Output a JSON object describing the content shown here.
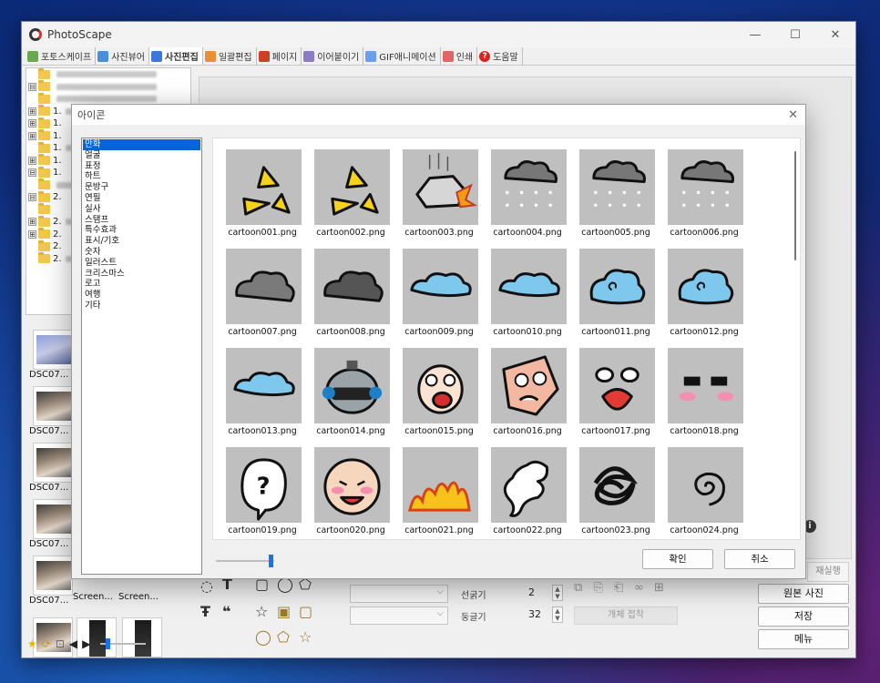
{
  "app": {
    "title": "PhotoScape",
    "window_controls": [
      "—",
      "☐",
      "✕"
    ]
  },
  "tabs": [
    {
      "label": "포토스케이프",
      "icon": "photoscape-icon",
      "color": "#6aa84f"
    },
    {
      "label": "사진뷰어",
      "icon": "viewer-icon",
      "color": "#4a90d9"
    },
    {
      "label": "사진편집",
      "icon": "editor-icon",
      "color": "#3c78d8",
      "active": true
    },
    {
      "label": "일괄편집",
      "icon": "batch-icon",
      "color": "#e69138"
    },
    {
      "label": "페이지",
      "icon": "page-icon",
      "color": "#cc4125"
    },
    {
      "label": "이어붙이기",
      "icon": "combine-icon",
      "color": "#8e7cc3"
    },
    {
      "label": "GIF애니메이션",
      "icon": "gif-icon",
      "color": "#6d9eeb"
    },
    {
      "label": "인쇄",
      "icon": "print-icon",
      "color": "#e06666"
    },
    {
      "label": "도움말",
      "icon": "help-icon",
      "color": "#d8241c"
    }
  ],
  "tree": {
    "rows": [
      {
        "exp": "",
        "label": ""
      },
      {
        "exp": "⊟",
        "label": ""
      },
      {
        "exp": "",
        "label": ""
      },
      {
        "exp": "⊞",
        "label": "1."
      },
      {
        "exp": "⊞",
        "label": "1."
      },
      {
        "exp": "⊞",
        "label": "1."
      },
      {
        "exp": "",
        "label": "1."
      },
      {
        "exp": "⊞",
        "label": "1."
      },
      {
        "exp": "⊟",
        "label": "1."
      },
      {
        "exp": "",
        "label": ""
      },
      {
        "exp": "⊟",
        "label": "2."
      },
      {
        "exp": "",
        "label": ""
      },
      {
        "exp": "⊞",
        "label": "2."
      },
      {
        "exp": "⊞",
        "label": "2."
      },
      {
        "exp": "",
        "label": "2."
      },
      {
        "exp": "",
        "label": "2."
      }
    ]
  },
  "thumbnails": [
    {
      "label": "DSC07...",
      "kind": "blue"
    },
    {
      "label": "DSC07...",
      "kind": "photo"
    },
    {
      "label": "DSC07...",
      "kind": "photo"
    },
    {
      "label": "DSC07...",
      "kind": "photo"
    },
    {
      "label": "DSC07...",
      "kind": "photo"
    },
    {
      "label": "Screen...",
      "kind": "dark"
    },
    {
      "label": "Screen...",
      "kind": "dark"
    },
    {
      "label": "",
      "kind": "photo"
    },
    {
      "label": "",
      "kind": "dark"
    },
    {
      "label": "",
      "kind": "dark"
    }
  ],
  "toolbar_bottom": {
    "labels": {
      "line_width": "선굵기",
      "rounding": "둥글기"
    },
    "values": {
      "line_width": "2",
      "rounding": "32"
    },
    "crop_button": "개체 접착"
  },
  "right_buttons": {
    "rerun": "재실행",
    "original": "원본 사진",
    "save": "저장",
    "menu": "메뉴"
  },
  "dialog": {
    "title": "아이콘",
    "categories": [
      "만화",
      "얼굴",
      "표정",
      "하트",
      "문방구",
      "연필",
      "실사",
      "스탬프",
      "특수효과",
      "표시/기호",
      "숫자",
      "일러스트",
      "크리스마스",
      "로고",
      "여행",
      "기타"
    ],
    "selected_category": "만화",
    "icons": [
      {
        "file": "cartoon001.png",
        "art": "yellow-burst-icon"
      },
      {
        "file": "cartoon002.png",
        "art": "yellow-burst-icon"
      },
      {
        "file": "cartoon003.png",
        "art": "rock-crash-icon"
      },
      {
        "file": "cartoon004.png",
        "art": "rain-cloud-icon"
      },
      {
        "file": "cartoon005.png",
        "art": "snow-cloud-icon"
      },
      {
        "file": "cartoon006.png",
        "art": "drizzle-cloud-icon"
      },
      {
        "file": "cartoon007.png",
        "art": "gray-cloud-icon"
      },
      {
        "file": "cartoon008.png",
        "art": "dark-smoke-icon"
      },
      {
        "file": "cartoon009.png",
        "art": "blue-cloud-icon"
      },
      {
        "file": "cartoon010.png",
        "art": "blue-cloud-icon"
      },
      {
        "file": "cartoon011.png",
        "art": "blue-swirl-cloud-icon"
      },
      {
        "file": "cartoon012.png",
        "art": "blue-swirl-cloud-icon"
      },
      {
        "file": "cartoon013.png",
        "art": "blue-flat-cloud-icon"
      },
      {
        "file": "cartoon014.png",
        "art": "robot-helmet-icon"
      },
      {
        "file": "cartoon015.png",
        "art": "screaming-face-icon"
      },
      {
        "file": "cartoon016.png",
        "art": "angry-face-icon"
      },
      {
        "file": "cartoon017.png",
        "art": "shouting-eyes-icon"
      },
      {
        "file": "cartoon018.png",
        "art": "blushing-eyes-icon"
      },
      {
        "file": "cartoon019.png",
        "art": "question-bubble-icon"
      },
      {
        "file": "cartoon020.png",
        "art": "happy-bald-face-icon"
      },
      {
        "file": "cartoon021.png",
        "art": "fire-icon"
      },
      {
        "file": "cartoon022.png",
        "art": "ghost-wisp-icon"
      },
      {
        "file": "cartoon023.png",
        "art": "scribble-icon"
      },
      {
        "file": "cartoon024.png",
        "art": "spiral-icon"
      }
    ],
    "ok_label": "확인",
    "cancel_label": "취소"
  }
}
